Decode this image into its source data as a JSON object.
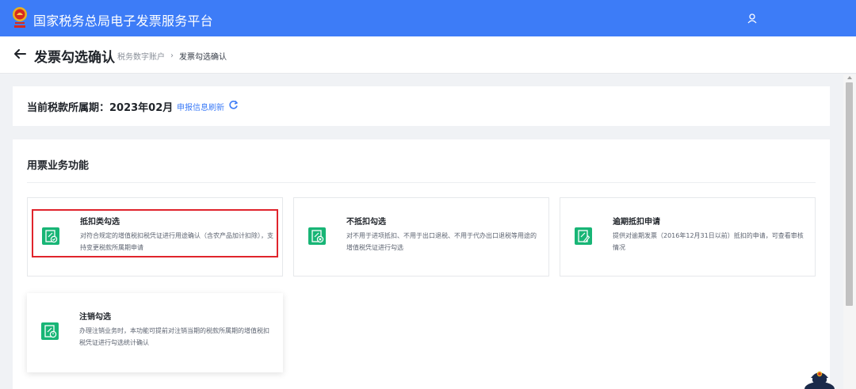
{
  "header": {
    "app_title": "国家税务总局电子发票服务平台",
    "logo_icon": "tax-emblem-icon",
    "user_icon": "user-icon",
    "bg_color": "#3d7cf7"
  },
  "subheader": {
    "title": "发票勾选确认",
    "breadcrumb": [
      "税务数字账户",
      "发票勾选确认"
    ],
    "back_icon": "arrow-left-icon"
  },
  "period": {
    "label": "当前税款所属期：2023年02月",
    "refresh_link": "申报信息刷新",
    "refresh_icon": "refresh-icon"
  },
  "functions": {
    "section_title": "用票业务功能",
    "accent_color": "#18b576",
    "tiles": [
      {
        "title": "抵扣类勾选",
        "desc": "对符合规定的增值税扣税凭证进行用途确认（含农产品加计扣除），支持变更税款所属期申请",
        "icon": "invoice-check-icon"
      },
      {
        "title": "不抵扣勾选",
        "desc": "对不用于进项抵扣、不用于出口退税、不用于代办出口退税等用途的增值税凭证进行勾选",
        "icon": "invoice-cancel-icon"
      },
      {
        "title": "逾期抵扣申请",
        "desc": "提供对逾期发票（2016年12月31日以前）抵扣的申请，可查看审核情况",
        "icon": "invoice-edit-icon"
      },
      {
        "title": "注销勾选",
        "desc": "办理注销业务时，本功能可提前对注销当期的税款所属期的增值税扣税凭证进行勾选统计确认",
        "icon": "invoice-power-icon"
      }
    ]
  },
  "highlight_color": "#e0242c"
}
